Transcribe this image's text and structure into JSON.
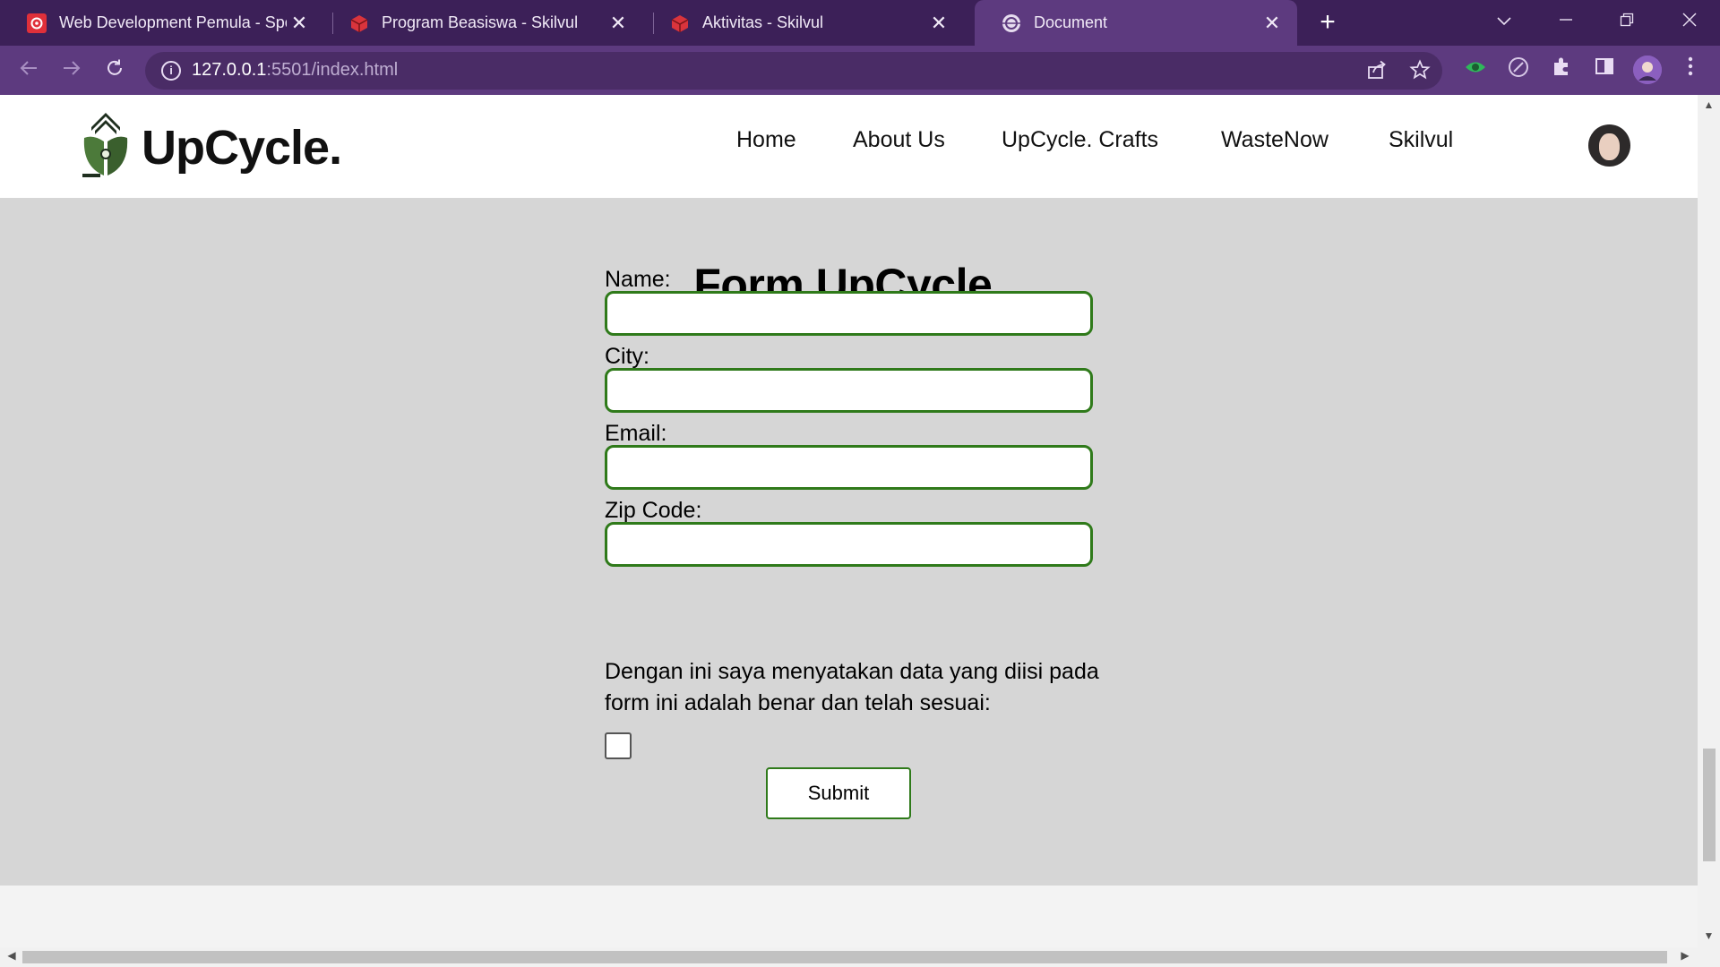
{
  "browser": {
    "tabs": [
      {
        "title": "Web Development Pemula - Spe",
        "favicon": "skilvul-red-favicon",
        "active": false
      },
      {
        "title": "Program Beasiswa - Skilvul",
        "favicon": "skilvul-cube-favicon",
        "active": false
      },
      {
        "title": "Aktivitas - Skilvul",
        "favicon": "skilvul-cube-favicon",
        "active": false
      },
      {
        "title": "Document",
        "favicon": "globe-favicon",
        "active": true
      }
    ],
    "close_glyph": "✕",
    "new_tab_glyph": "+",
    "url_host": "127.0.0.1",
    "url_path": ":5501/index.html",
    "colors": {
      "tabbar": "#3c2058",
      "toolbar": "#5d3a7f",
      "accent_green": "#2f7a1a"
    }
  },
  "site": {
    "brand": "UpCycle.",
    "nav": [
      "Home",
      "About Us",
      "UpCycle. Crafts",
      "WasteNow",
      "Skilvul"
    ]
  },
  "form": {
    "title": "Form UpCycle.",
    "fields": [
      {
        "label": "Name:",
        "value": ""
      },
      {
        "label": "City:",
        "value": ""
      },
      {
        "label": "Email:",
        "value": ""
      },
      {
        "label": "Zip Code:",
        "value": ""
      }
    ],
    "consent_text": "Dengan ini saya menyatakan data yang diisi pada form ini adalah benar dan telah sesuai:",
    "consent_checked": false,
    "submit_label": "Submit"
  }
}
